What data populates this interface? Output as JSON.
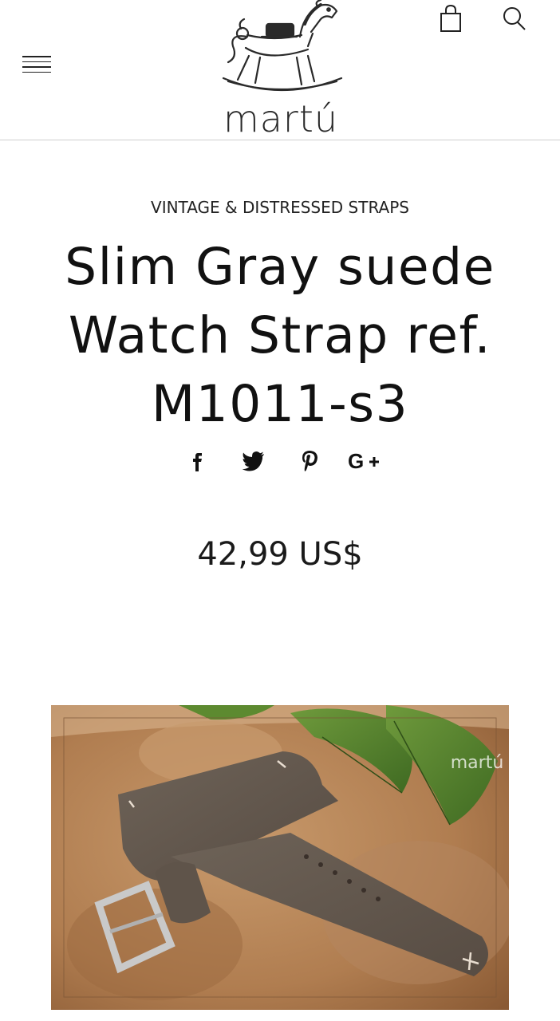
{
  "header": {
    "brand": "martú",
    "menu_icon": "hamburger-menu-icon",
    "cart_icon": "shopping-bag-icon",
    "search_icon": "search-icon"
  },
  "product": {
    "category": "VINTAGE & DISTRESSED STRAPS",
    "title": "Slim Gray suede Watch Strap ref. M1011-s3",
    "price": "42,99 US$",
    "image_watermark": "martú"
  },
  "share": [
    {
      "network": "facebook",
      "icon": "facebook-icon"
    },
    {
      "network": "twitter",
      "icon": "twitter-icon"
    },
    {
      "network": "pinterest",
      "icon": "pinterest-icon"
    },
    {
      "network": "google-plus",
      "icon": "google-plus-icon"
    }
  ],
  "colors": {
    "text": "#111111",
    "divider": "#cfcfcf",
    "background": "#ffffff"
  }
}
